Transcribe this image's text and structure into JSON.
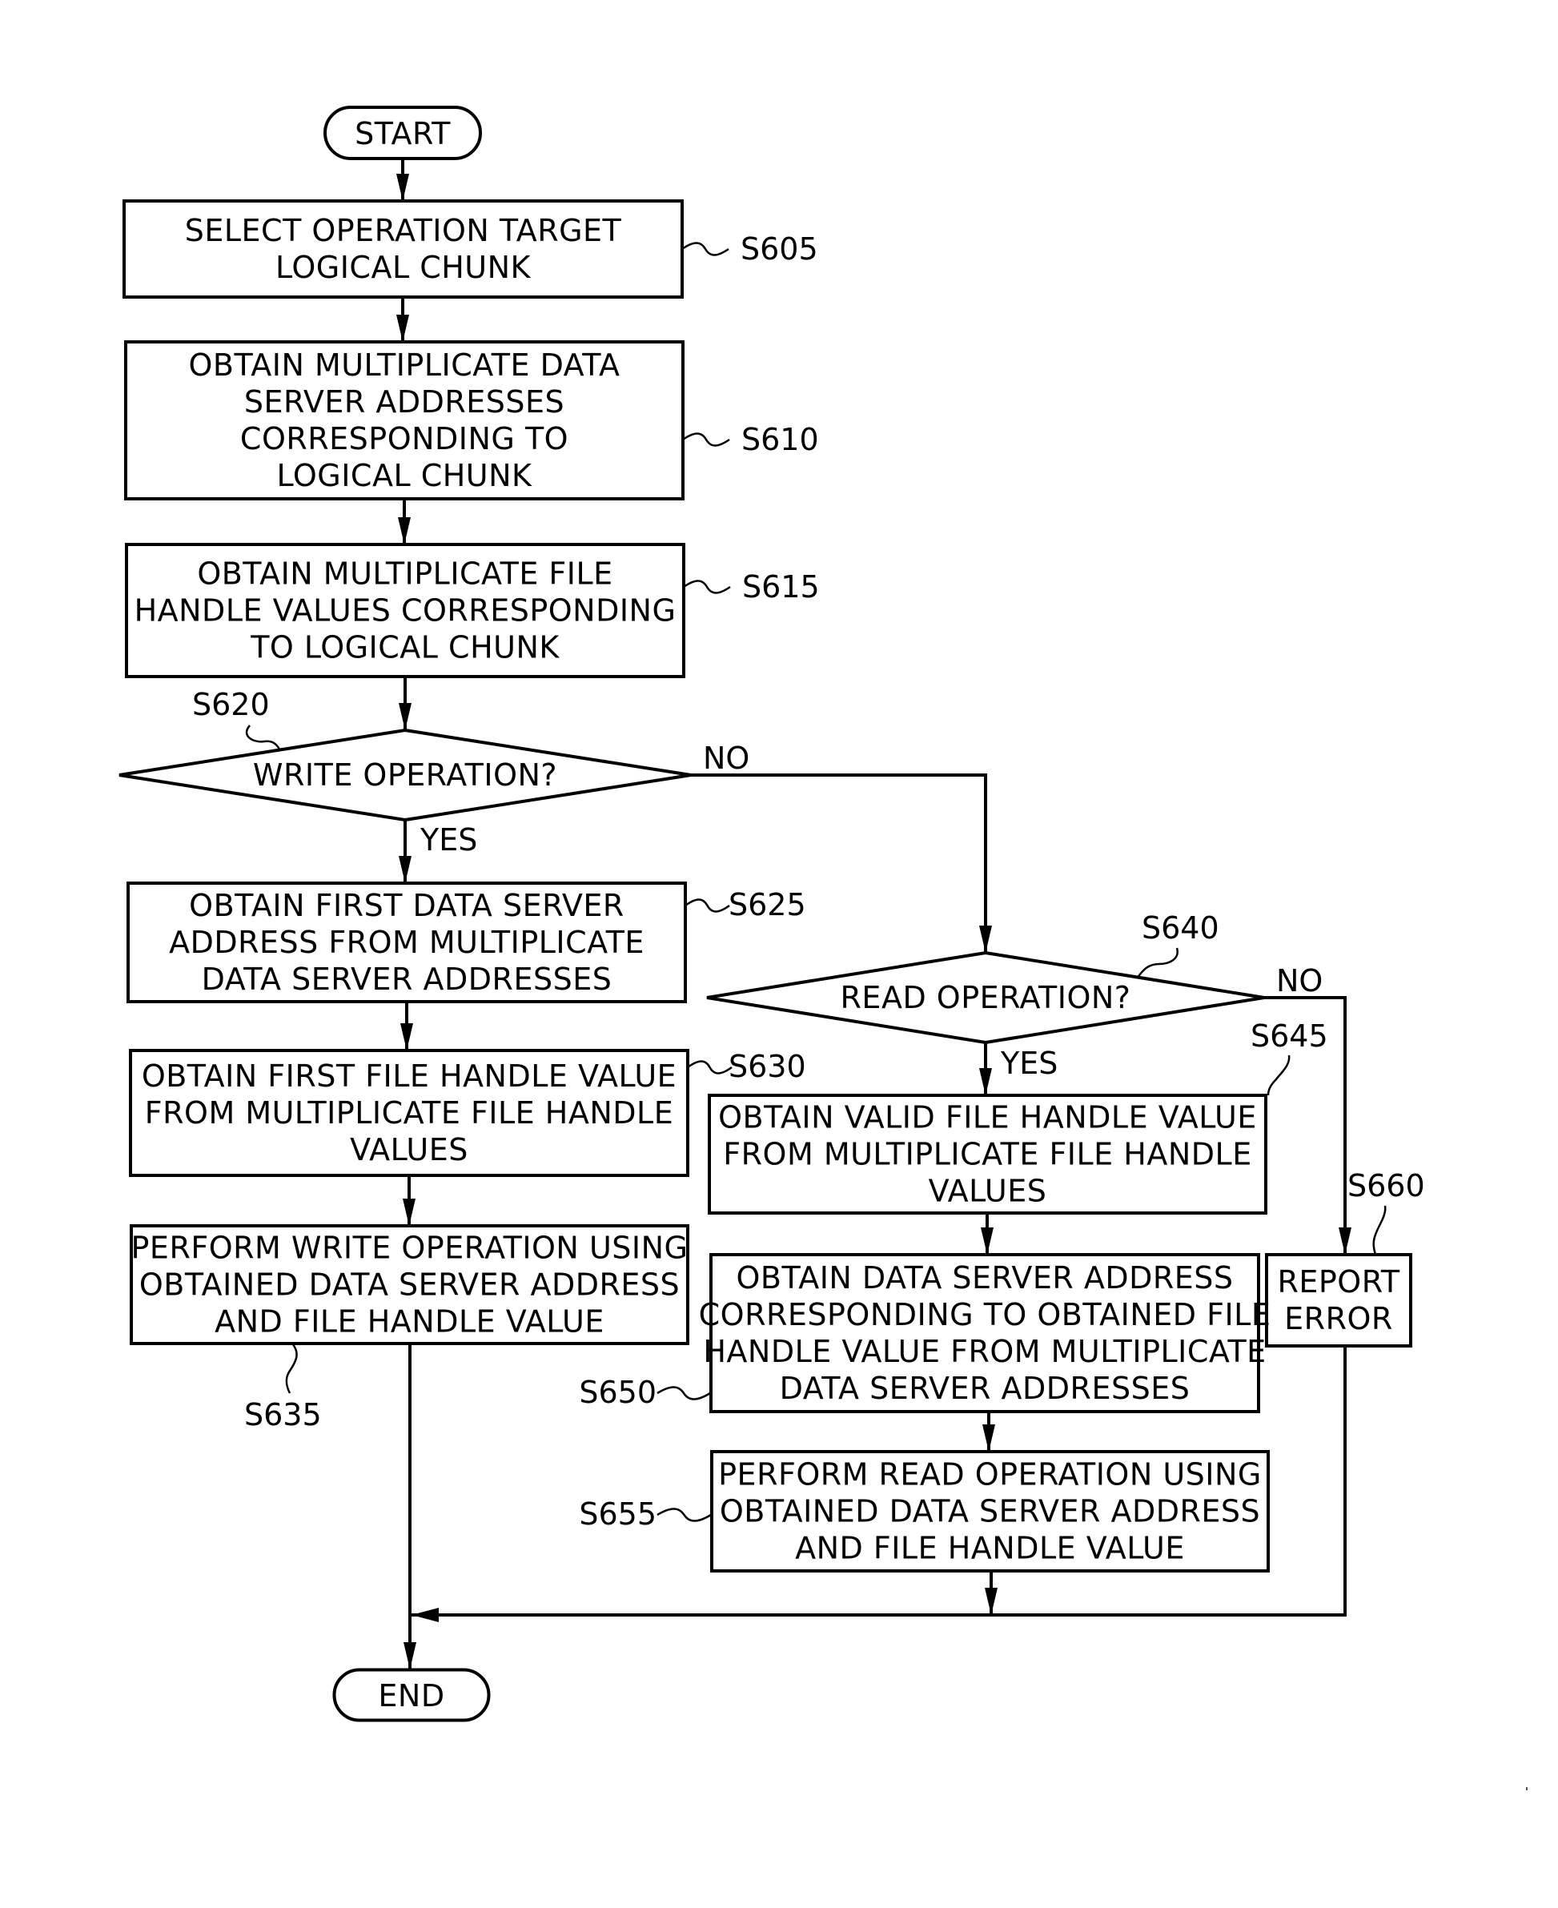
{
  "figure": {
    "type": "flowchart",
    "terminals": {
      "start": "START",
      "end": "END"
    },
    "steps": [
      {
        "id": "S605",
        "kind": "process",
        "lines": [
          "SELECT OPERATION TARGET",
          "LOGICAL CHUNK"
        ]
      },
      {
        "id": "S610",
        "kind": "process",
        "lines": [
          "OBTAIN MULTIPLICATE DATA",
          "SERVER ADDRESSES",
          "CORRESPONDING TO",
          "LOGICAL CHUNK"
        ]
      },
      {
        "id": "S615",
        "kind": "process",
        "lines": [
          "OBTAIN MULTIPLICATE FILE",
          "HANDLE VALUES CORRESPONDING",
          "TO LOGICAL CHUNK"
        ]
      },
      {
        "id": "S620",
        "kind": "decision",
        "lines": [
          "WRITE OPERATION?"
        ]
      },
      {
        "id": "S625",
        "kind": "process",
        "lines": [
          "OBTAIN FIRST DATA SERVER",
          "ADDRESS FROM MULTIPLICATE",
          "DATA SERVER ADDRESSES"
        ]
      },
      {
        "id": "S630",
        "kind": "process",
        "lines": [
          "OBTAIN FIRST FILE HANDLE VALUE",
          "FROM MULTIPLICATE FILE HANDLE",
          "VALUES"
        ]
      },
      {
        "id": "S635",
        "kind": "process",
        "lines": [
          "PERFORM WRITE OPERATION USING",
          "OBTAINED DATA SERVER ADDRESS",
          "AND FILE HANDLE VALUE"
        ]
      },
      {
        "id": "S640",
        "kind": "decision",
        "lines": [
          "READ OPERATION?"
        ]
      },
      {
        "id": "S645",
        "kind": "process",
        "lines": [
          "OBTAIN VALID FILE HANDLE VALUE",
          "FROM MULTIPLICATE FILE HANDLE",
          "VALUES"
        ]
      },
      {
        "id": "S650",
        "kind": "process",
        "lines": [
          "OBTAIN DATA SERVER ADDRESS",
          "CORRESPONDING TO OBTAINED FILE",
          "HANDLE VALUE FROM MULTIPLICATE",
          "DATA SERVER ADDRESSES"
        ]
      },
      {
        "id": "S655",
        "kind": "process",
        "lines": [
          "PERFORM READ OPERATION USING",
          "OBTAINED DATA SERVER ADDRESS",
          "AND FILE HANDLE VALUE"
        ]
      },
      {
        "id": "S660",
        "kind": "process",
        "lines": [
          "REPORT",
          "ERROR"
        ]
      }
    ],
    "branch_labels": {
      "s620_yes": "YES",
      "s620_no": "NO",
      "s640_yes": "YES",
      "s640_no": "NO"
    },
    "edges": [
      [
        "START",
        "S605"
      ],
      [
        "S605",
        "S610"
      ],
      [
        "S610",
        "S615"
      ],
      [
        "S615",
        "S620"
      ],
      [
        "S620:YES",
        "S625"
      ],
      [
        "S625",
        "S630"
      ],
      [
        "S630",
        "S635"
      ],
      [
        "S635",
        "END"
      ],
      [
        "S620:NO",
        "S640"
      ],
      [
        "S640:YES",
        "S645"
      ],
      [
        "S645",
        "S650"
      ],
      [
        "S650",
        "S655"
      ],
      [
        "S655",
        "END"
      ],
      [
        "S640:NO",
        "S660"
      ],
      [
        "S660",
        "END"
      ]
    ]
  }
}
